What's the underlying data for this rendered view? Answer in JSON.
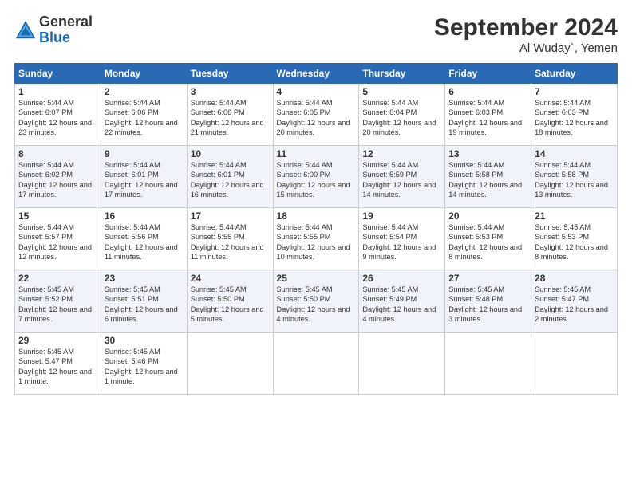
{
  "header": {
    "logo_general": "General",
    "logo_blue": "Blue",
    "month_title": "September 2024",
    "location": "Al Wuday`, Yemen"
  },
  "days_of_week": [
    "Sunday",
    "Monday",
    "Tuesday",
    "Wednesday",
    "Thursday",
    "Friday",
    "Saturday"
  ],
  "weeks": [
    [
      {
        "day": 1,
        "sunrise": "5:44 AM",
        "sunset": "6:07 PM",
        "daylight": "12 hours and 23 minutes."
      },
      {
        "day": 2,
        "sunrise": "5:44 AM",
        "sunset": "6:06 PM",
        "daylight": "12 hours and 22 minutes."
      },
      {
        "day": 3,
        "sunrise": "5:44 AM",
        "sunset": "6:06 PM",
        "daylight": "12 hours and 21 minutes."
      },
      {
        "day": 4,
        "sunrise": "5:44 AM",
        "sunset": "6:05 PM",
        "daylight": "12 hours and 20 minutes."
      },
      {
        "day": 5,
        "sunrise": "5:44 AM",
        "sunset": "6:04 PM",
        "daylight": "12 hours and 20 minutes."
      },
      {
        "day": 6,
        "sunrise": "5:44 AM",
        "sunset": "6:03 PM",
        "daylight": "12 hours and 19 minutes."
      },
      {
        "day": 7,
        "sunrise": "5:44 AM",
        "sunset": "6:03 PM",
        "daylight": "12 hours and 18 minutes."
      }
    ],
    [
      {
        "day": 8,
        "sunrise": "5:44 AM",
        "sunset": "6:02 PM",
        "daylight": "12 hours and 17 minutes."
      },
      {
        "day": 9,
        "sunrise": "5:44 AM",
        "sunset": "6:01 PM",
        "daylight": "12 hours and 17 minutes."
      },
      {
        "day": 10,
        "sunrise": "5:44 AM",
        "sunset": "6:01 PM",
        "daylight": "12 hours and 16 minutes."
      },
      {
        "day": 11,
        "sunrise": "5:44 AM",
        "sunset": "6:00 PM",
        "daylight": "12 hours and 15 minutes."
      },
      {
        "day": 12,
        "sunrise": "5:44 AM",
        "sunset": "5:59 PM",
        "daylight": "12 hours and 14 minutes."
      },
      {
        "day": 13,
        "sunrise": "5:44 AM",
        "sunset": "5:58 PM",
        "daylight": "12 hours and 14 minutes."
      },
      {
        "day": 14,
        "sunrise": "5:44 AM",
        "sunset": "5:58 PM",
        "daylight": "12 hours and 13 minutes."
      }
    ],
    [
      {
        "day": 15,
        "sunrise": "5:44 AM",
        "sunset": "5:57 PM",
        "daylight": "12 hours and 12 minutes."
      },
      {
        "day": 16,
        "sunrise": "5:44 AM",
        "sunset": "5:56 PM",
        "daylight": "12 hours and 11 minutes."
      },
      {
        "day": 17,
        "sunrise": "5:44 AM",
        "sunset": "5:55 PM",
        "daylight": "12 hours and 11 minutes."
      },
      {
        "day": 18,
        "sunrise": "5:44 AM",
        "sunset": "5:55 PM",
        "daylight": "12 hours and 10 minutes."
      },
      {
        "day": 19,
        "sunrise": "5:44 AM",
        "sunset": "5:54 PM",
        "daylight": "12 hours and 9 minutes."
      },
      {
        "day": 20,
        "sunrise": "5:44 AM",
        "sunset": "5:53 PM",
        "daylight": "12 hours and 8 minutes."
      },
      {
        "day": 21,
        "sunrise": "5:45 AM",
        "sunset": "5:53 PM",
        "daylight": "12 hours and 8 minutes."
      }
    ],
    [
      {
        "day": 22,
        "sunrise": "5:45 AM",
        "sunset": "5:52 PM",
        "daylight": "12 hours and 7 minutes."
      },
      {
        "day": 23,
        "sunrise": "5:45 AM",
        "sunset": "5:51 PM",
        "daylight": "12 hours and 6 minutes."
      },
      {
        "day": 24,
        "sunrise": "5:45 AM",
        "sunset": "5:50 PM",
        "daylight": "12 hours and 5 minutes."
      },
      {
        "day": 25,
        "sunrise": "5:45 AM",
        "sunset": "5:50 PM",
        "daylight": "12 hours and 4 minutes."
      },
      {
        "day": 26,
        "sunrise": "5:45 AM",
        "sunset": "5:49 PM",
        "daylight": "12 hours and 4 minutes."
      },
      {
        "day": 27,
        "sunrise": "5:45 AM",
        "sunset": "5:48 PM",
        "daylight": "12 hours and 3 minutes."
      },
      {
        "day": 28,
        "sunrise": "5:45 AM",
        "sunset": "5:47 PM",
        "daylight": "12 hours and 2 minutes."
      }
    ],
    [
      {
        "day": 29,
        "sunrise": "5:45 AM",
        "sunset": "5:47 PM",
        "daylight": "12 hours and 1 minute."
      },
      {
        "day": 30,
        "sunrise": "5:45 AM",
        "sunset": "5:46 PM",
        "daylight": "12 hours and 1 minute."
      },
      null,
      null,
      null,
      null,
      null
    ]
  ]
}
